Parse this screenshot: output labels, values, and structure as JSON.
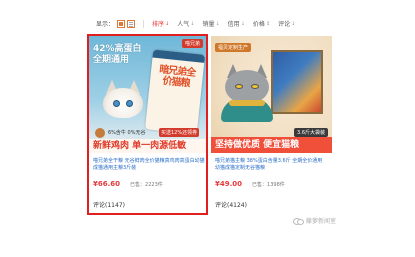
{
  "toolbar": {
    "display_label": "显示：",
    "sort_items": [
      {
        "label": "排序",
        "arrow": "↓"
      },
      {
        "label": "人气",
        "arrow": "↓"
      },
      {
        "label": "销量",
        "arrow": "↓"
      },
      {
        "label": "信用",
        "arrow": "↓"
      },
      {
        "label": "价格",
        "arrow": "↕"
      },
      {
        "label": "评论",
        "arrow": "↓"
      }
    ]
  },
  "products": [
    {
      "corner_tag": "喵兄弟",
      "promo_line1": "42%高蛋白",
      "promo_line2": "全期通用",
      "bag_text": "暗兄弟全价猫粮",
      "stat": "6%含牛 0%无谷",
      "small_tag": "买送12%还领券",
      "slogan": "新鲜鸡肉 单一肉源低敏",
      "title": "喵兄弟全干粮 无谷鲜肉全价猫粮真鸡肉高蛋白幼猫成猫通用主粮3斤装",
      "price": "66.60",
      "sold": "已售：2223件",
      "review": "评论(1147)"
    },
    {
      "corner_tag": "福贝定制生产",
      "size_tag": "3.6斤大袋装",
      "slogan": "坚持做优质 便宜猫粮",
      "title": "喵兄弟猫主粮 38%蛋白含量3.6斤 全期全价通用幼猫成猫定制无谷猫粮",
      "price": "49.00",
      "sold": "已售：1398件",
      "review": "评论(4124)"
    }
  ],
  "watermark": "藤萝新闻室",
  "colors": {
    "accent_red": "#e4393c",
    "highlight_border": "#e02020",
    "link_blue": "#2a6fc8"
  }
}
